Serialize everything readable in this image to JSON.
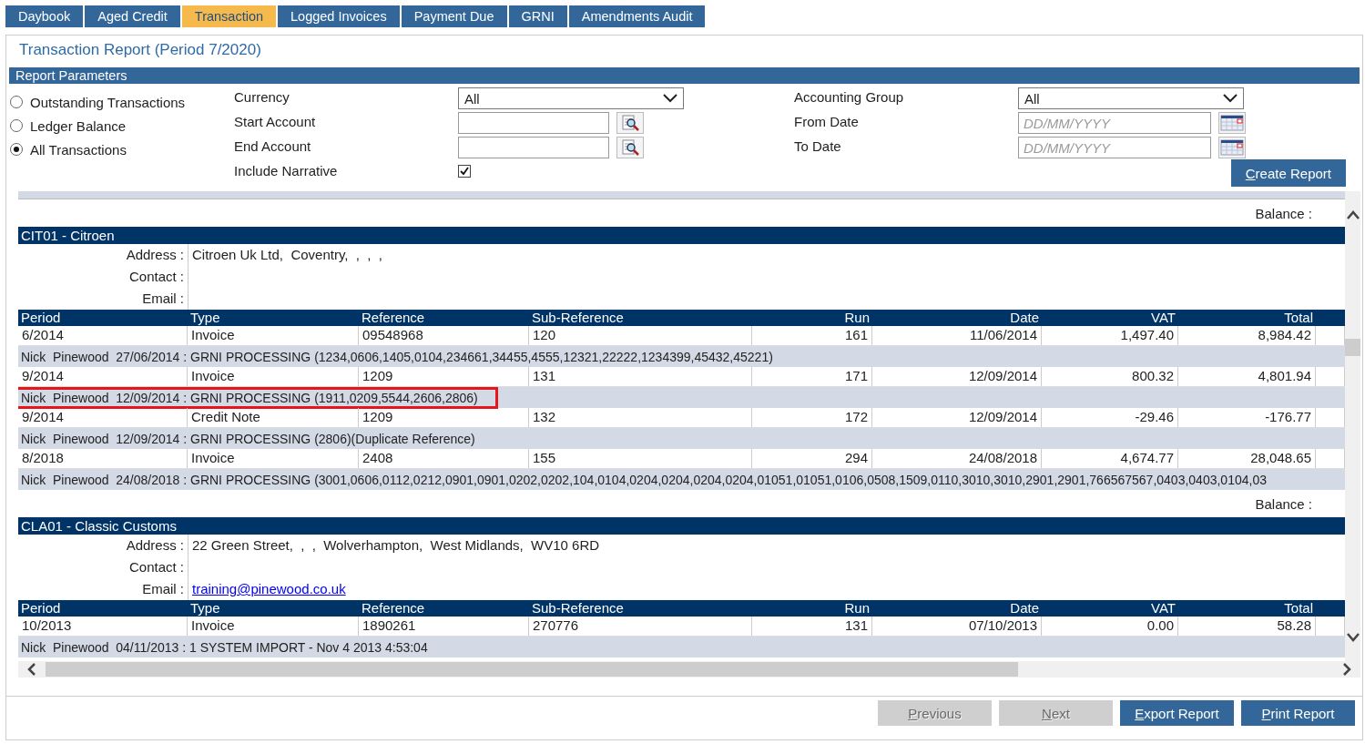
{
  "tabs": [
    {
      "label": "Daybook",
      "selected": false
    },
    {
      "label": "Aged Credit",
      "selected": false
    },
    {
      "label": "Transaction",
      "selected": true
    },
    {
      "label": "Logged Invoices",
      "selected": false
    },
    {
      "label": "Payment Due",
      "selected": false
    },
    {
      "label": "GRNI",
      "selected": false
    },
    {
      "label": "Amendments Audit",
      "selected": false
    }
  ],
  "title": "Transaction Report (Period 7/2020)",
  "parameters": {
    "header": "Report Parameters",
    "radios": [
      {
        "label": "Outstanding Transactions",
        "selected": false
      },
      {
        "label": "Ledger Balance",
        "selected": false
      },
      {
        "label": "All Transactions",
        "selected": true
      }
    ],
    "left_fields": [
      {
        "label": "Currency",
        "kind": "select",
        "value": "All"
      },
      {
        "label": "Start Account",
        "kind": "lookup"
      },
      {
        "label": "End Account",
        "kind": "lookup"
      },
      {
        "label": "Include Narrative",
        "kind": "checkbox",
        "checked": true
      }
    ],
    "right_fields": [
      {
        "label": "Accounting Group",
        "kind": "select",
        "value": "All"
      },
      {
        "label": "From Date",
        "kind": "date",
        "placeholder": "DD/MM/YYYY"
      },
      {
        "label": "To Date",
        "kind": "date",
        "placeholder": "DD/MM/YYYY"
      }
    ],
    "create_button": "Create Report"
  },
  "report": {
    "top_balance": "Balance :",
    "accounts": [
      {
        "heading": "CIT01 - Citroen",
        "columns": [
          "Period",
          "Type",
          "Reference",
          "Sub-Reference",
          "Run",
          "Date",
          "VAT",
          "Total"
        ],
        "details": [
          {
            "label": "Address :",
            "kind": "text",
            "value": "Citroen Uk Ltd,  Coventry,  ,  ,  ,"
          },
          {
            "label": "Contact :",
            "kind": "text"
          },
          {
            "label": "Email :",
            "kind": "text"
          }
        ],
        "rows": [
          {
            "cells": [
              "6/2014",
              "Invoice",
              "09548968",
              "120",
              "161",
              "11/06/2014",
              "1,497.40",
              "8,984.42"
            ],
            "narrative": "Nick  Pinewood  27/06/2014 : GRNI PROCESSING (1234,0606,1405,0104,234661,34455,4555,12321,22222,1234399,45432,45221)",
            "highlighted": false
          },
          {
            "cells": [
              "9/2014",
              "Invoice",
              "1209",
              "131",
              "171",
              "12/09/2014",
              "800.32",
              "4,801.94"
            ],
            "narrative": "Nick  Pinewood  12/09/2014 : GRNI PROCESSING (1911,0209,5544,2606,2806)",
            "highlighted": true
          },
          {
            "cells": [
              "9/2014",
              "Credit Note",
              "1209",
              "132",
              "172",
              "12/09/2014",
              "-29.46",
              "-176.77"
            ],
            "narrative": "Nick  Pinewood  12/09/2014 : GRNI PROCESSING (2806)(Duplicate Reference)",
            "highlighted": false
          },
          {
            "cells": [
              "8/2018",
              "Invoice",
              "2408",
              "155",
              "294",
              "24/08/2018",
              "4,674.77",
              "28,048.65"
            ],
            "narrative": "Nick  Pinewood  24/08/2018 : GRNI PROCESSING (3001,0606,0112,0212,0901,0901,0202,0202,104,0104,0204,0204,0204,0204,01051,01051,0106,0508,1509,0110,3010,3010,2901,2901,766567567,0403,0403,0104,03",
            "highlighted": false
          }
        ],
        "balance": "Balance :"
      },
      {
        "heading": "CLA01 - Classic Customs",
        "columns": [
          "Period",
          "Type",
          "Reference",
          "Sub-Reference",
          "Run",
          "Date",
          "VAT",
          "Total"
        ],
        "details": [
          {
            "label": "Address :",
            "kind": "text",
            "value": "22 Green Street,  ,  ,  Wolverhampton,  West Midlands,  WV10 6RD"
          },
          {
            "label": "Contact :",
            "kind": "text"
          },
          {
            "label": "Email :",
            "kind": "link",
            "value": "training@pinewood.co.uk"
          }
        ],
        "rows": [
          {
            "cells": [
              "10/2013",
              "Invoice",
              "1890261",
              "270776",
              "131",
              "07/10/2013",
              "0.00",
              "58.28"
            ],
            "narrative": "Nick  Pinewood  04/11/2013 : 1 SYSTEM IMPORT - Nov 4 2013 4:53:04",
            "highlighted": false
          }
        ]
      }
    ]
  },
  "footer_buttons": [
    {
      "label": "Previous",
      "disabled": true
    },
    {
      "label": "Next",
      "disabled": true
    },
    {
      "label": "Export Report",
      "disabled": false
    },
    {
      "label": "Print Report",
      "disabled": false
    }
  ]
}
